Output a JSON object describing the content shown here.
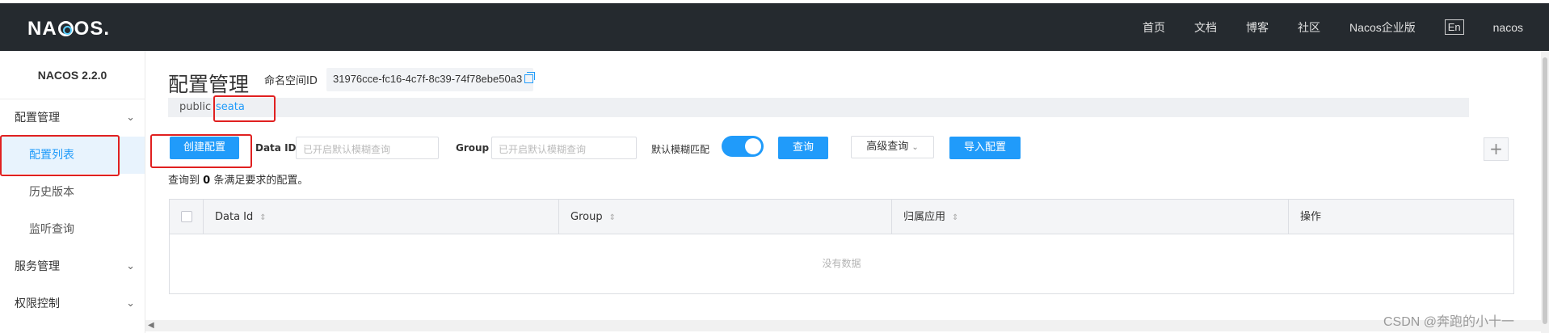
{
  "topbar": {
    "logo_text": "NA",
    "logo_text_2": "OS",
    "nav": [
      "首页",
      "文档",
      "博客",
      "社区",
      "Nacos企业版"
    ],
    "lang": "En",
    "user": "nacos"
  },
  "sidebar": {
    "version": "NACOS 2.2.0",
    "groups": [
      {
        "label": "配置管理",
        "expanded": true,
        "items": [
          "配置列表",
          "历史版本",
          "监听查询"
        ]
      },
      {
        "label": "服务管理",
        "expanded": false
      },
      {
        "label": "权限控制",
        "expanded": false
      }
    ],
    "active_item": "配置列表"
  },
  "main": {
    "title": "配置管理",
    "namespace_label": "命名空间ID",
    "namespace_id": "31976cce-fc16-4c7f-8c39-74f78ebe50a3",
    "namespace_tabs": [
      "public",
      "seata"
    ],
    "active_namespace": "seata",
    "create_button": "创建配置",
    "data_id_label": "Data ID",
    "data_id_placeholder": "已开启默认模糊查询",
    "group_label": "Group",
    "group_placeholder": "已开启默认模糊查询",
    "fuzzy_label": "默认模糊匹配",
    "fuzzy_enabled": true,
    "query_button": "查询",
    "advanced_button": "高级查询",
    "import_button": "导入配置",
    "result_prefix": "查询到",
    "result_count": "0",
    "result_suffix": "条满足要求的配置。",
    "table": {
      "columns": [
        "Data Id",
        "Group",
        "归属应用",
        "操作"
      ],
      "empty_text": "没有数据"
    }
  },
  "watermark": "CSDN @奔跑的小十一",
  "colors": {
    "accent": "#209bfa",
    "topbar_bg": "#252a2f",
    "highlight": "#e02020"
  }
}
